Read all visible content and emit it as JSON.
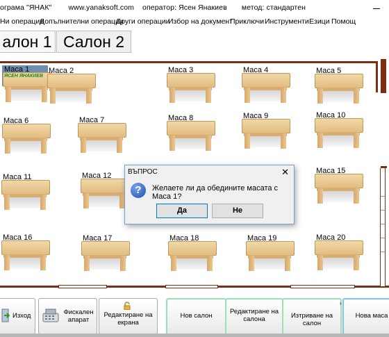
{
  "window": {
    "title_text": "ограма \"ЯНАК\"        www.yanaksoft.com    оператор: Ясен Янакиев       метод: стандартен"
  },
  "menu": [
    "Ни операции",
    "Допълнителни операции",
    "Други операции",
    "Избор на документ",
    "Приключи",
    "Инструменти",
    "Езици",
    "Помощ"
  ],
  "tabs": [
    {
      "label": "алон 1",
      "active": true
    },
    {
      "label": "Салон 2",
      "active": false
    }
  ],
  "tables": {
    "t1": {
      "label": "Маса 1",
      "waiter": "ЯСЕН ЯНАКИЕВ"
    },
    "t2": {
      "label": "Маса 2"
    },
    "t3": {
      "label": "Маса 3"
    },
    "t4": {
      "label": "Маса 4"
    },
    "t5": {
      "label": "Маса 5"
    },
    "t6": {
      "label": "Маса 6"
    },
    "t7": {
      "label": "Маса 7"
    },
    "t8": {
      "label": "Маса 8"
    },
    "t9": {
      "label": "Маса 9"
    },
    "t10": {
      "label": "Маса 10"
    },
    "t11": {
      "label": "Маса 11"
    },
    "t12": {
      "label": "Маса 12"
    },
    "t15": {
      "label": "Маса 15"
    },
    "t16": {
      "label": "Маса 16"
    },
    "t17": {
      "label": "Маса 17"
    },
    "t18": {
      "label": "Маса 18"
    },
    "t19": {
      "label": "Маса 19"
    },
    "t20": {
      "label": "Маса 20"
    }
  },
  "dialog": {
    "title": "ВЪПРОС",
    "close": "✕",
    "message": "Желаете ли да обедините масата с Маса 1?",
    "yes": "Да",
    "no": "Не"
  },
  "bottom_buttons": {
    "exit": "Изход",
    "fiscal": "Фискален\nапарат",
    "edit_screen": "Редактиране на\nекрана",
    "new_hall": "Нов салон",
    "edit_hall": "Редактиране на\nсалона",
    "delete_hall": "Изтриване на салон",
    "new_table": "Нова маса"
  },
  "colors": {
    "wall": "#7a2e12",
    "tabletop": "#e9c993",
    "dialog_border": "#7a9cc9",
    "green_button_border": "#9de0b3",
    "blue_button_border": "#7ec3f0"
  },
  "icons": {
    "exit": "exit-door-icon",
    "fiscal": "cash-register-icon",
    "edit": "padlock-icon",
    "question": "question-icon"
  }
}
